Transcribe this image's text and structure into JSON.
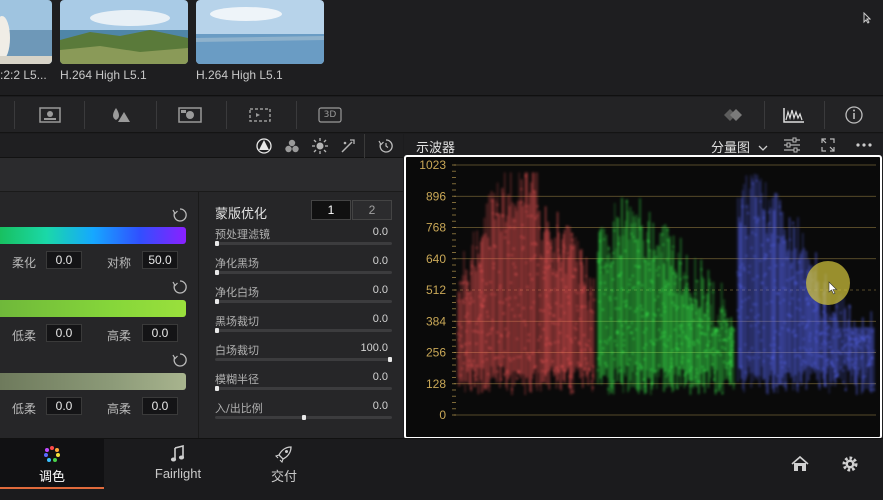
{
  "media": {
    "clips": [
      {
        "label": ":2:2 L5..."
      },
      {
        "label": "H.264 High L5.1"
      },
      {
        "label": "H.264 High L5.1"
      }
    ]
  },
  "toolbar": {
    "icons": [
      "viewer-icon",
      "color-picker-icon",
      "node-graph-icon",
      "cycle-icon",
      "3d-icon",
      "effects-icon",
      "scopes-icon",
      "info-icon"
    ],
    "label_3d": "3D"
  },
  "left": {
    "rows": [
      {
        "label_a": "柔化",
        "value_a": "0.0",
        "label_b": "对称",
        "value_b": "50.0"
      },
      {
        "label_a": "低柔",
        "value_a": "0.0",
        "label_b": "高柔",
        "value_b": "0.0"
      },
      {
        "label_a": "低柔",
        "value_a": "0.0",
        "label_b": "高柔",
        "value_b": "0.0"
      }
    ],
    "mask": {
      "title": "蒙版优化",
      "tabs": [
        "1",
        "2"
      ],
      "sliders": [
        {
          "label": "预处理滤镜",
          "value": "0.0",
          "level": 0.0
        },
        {
          "label": "净化黑场",
          "value": "0.0",
          "level": 0.0
        },
        {
          "label": "净化白场",
          "value": "0.0",
          "level": 0.0
        },
        {
          "label": "黑场裁切",
          "value": "0.0",
          "level": 0.0
        },
        {
          "label": "白场裁切",
          "value": "100.0",
          "level": 1.0
        },
        {
          "label": "模糊半径",
          "value": "0.0",
          "level": 0.0
        },
        {
          "label": "入/出比例",
          "value": "0.0",
          "level": 0.5
        }
      ]
    }
  },
  "scope": {
    "title": "示波器",
    "mode": "分量图",
    "ticks": [
      "1023",
      "896",
      "768",
      "640",
      "512",
      "384",
      "256",
      "128",
      "0"
    ],
    "colors": {
      "red": "#ff5a5a",
      "green": "#3cff50",
      "blue": "#5a6aff",
      "tick": "#c9a857"
    }
  },
  "bottom": {
    "tabs": [
      {
        "label": "调色",
        "active": true
      },
      {
        "label": "Fairlight",
        "active": false
      },
      {
        "label": "交付",
        "active": false
      }
    ]
  }
}
